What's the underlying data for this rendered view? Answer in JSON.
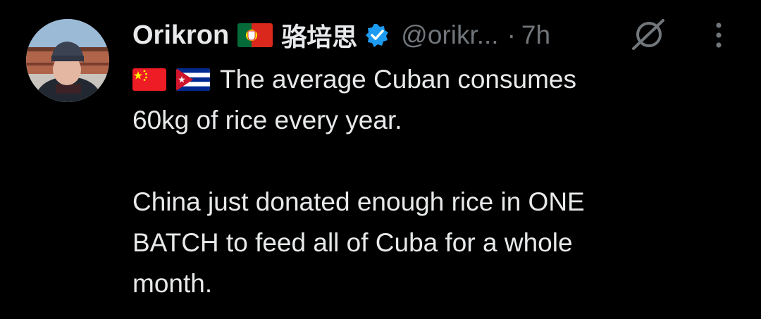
{
  "tweet": {
    "display_name": "Orikron",
    "name_flag_icon": "portugal-flag-icon",
    "chinese_name": "骆培思",
    "verified_icon": "verified-badge-icon",
    "handle": "@orikr...",
    "separator": "·",
    "timestamp": "7h",
    "grok_icon": "grok-icon",
    "more_icon": "more-vertical-icon",
    "text_flags": [
      "china-flag-icon",
      "cuba-flag-icon"
    ],
    "lines": [
      "The average Cuban consumes",
      "60kg of rice every year.",
      "China just donated enough rice in ONE",
      "BATCH to feed all of Cuba for a whole",
      "month."
    ]
  },
  "colors": {
    "background": "#000000",
    "text_primary": "#e7e9ea",
    "text_secondary": "#71767b",
    "verified_blue": "#1d9bf0"
  }
}
